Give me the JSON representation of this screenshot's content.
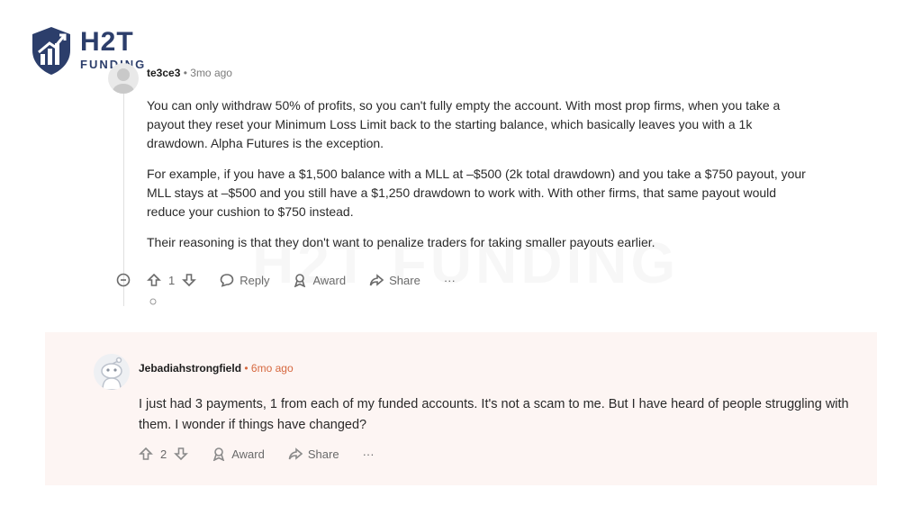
{
  "logo": {
    "brand": "H2T",
    "sub": "FUNDING"
  },
  "watermark": "H2T FUNDING",
  "comment1": {
    "username": "te3ce3",
    "separator": "•",
    "time": "3mo ago",
    "paragraphs": [
      "You can only withdraw 50% of profits, so you can't fully empty the account. With most prop firms, when you take a payout they reset your Minimum Loss Limit back to the starting balance, which basically leaves you with a 1k drawdown. Alpha Futures is the exception.",
      "For example, if you have a $1,500 balance with a MLL at –$500 (2k total drawdown) and you take a $750 payout, your MLL stays at –$500 and you still have a $1,250 drawdown to work with. With other firms, that same payout would reduce your cushion to $750 instead.",
      "Their reasoning is that they don't want to penalize traders for taking smaller payouts earlier."
    ],
    "votes": "1",
    "reply_label": "Reply",
    "award_label": "Award",
    "share_label": "Share",
    "more_label": "···"
  },
  "comment2": {
    "username": "Jebadiahstrongfield",
    "separator": "•",
    "time": "6mo ago",
    "body": "I just had 3 payments, 1 from each of my funded accounts. It's not a scam to me. But I have heard of people struggling with them. I wonder if things have changed?",
    "votes": "2",
    "award_label": "Award",
    "share_label": "Share",
    "more_label": "···"
  },
  "colors": {
    "brand": "#2c3e6b",
    "card_bg": "#fdf5f3",
    "time_accent": "#d6683f"
  }
}
